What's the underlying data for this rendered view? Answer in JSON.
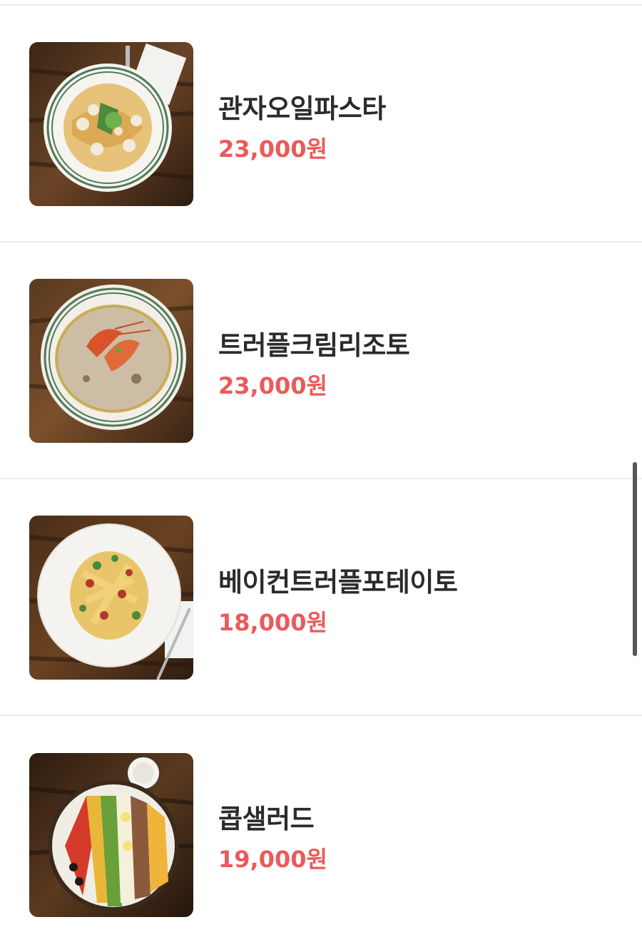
{
  "menu": {
    "items": [
      {
        "name": "관자오일파스타",
        "price": "23,000원",
        "image": "scallop-oil-pasta-photo"
      },
      {
        "name": "트러플크림리조토",
        "price": "23,000원",
        "image": "truffle-cream-risotto-photo"
      },
      {
        "name": "베이컨트러플포테이토",
        "price": "18,000원",
        "image": "bacon-truffle-potato-photo"
      },
      {
        "name": "콥샐러드",
        "price": "19,000원",
        "image": "cobb-salad-photo"
      }
    ]
  },
  "colors": {
    "price": "#ea5a5a",
    "name": "#2b2b2b",
    "divider": "#ececef"
  }
}
